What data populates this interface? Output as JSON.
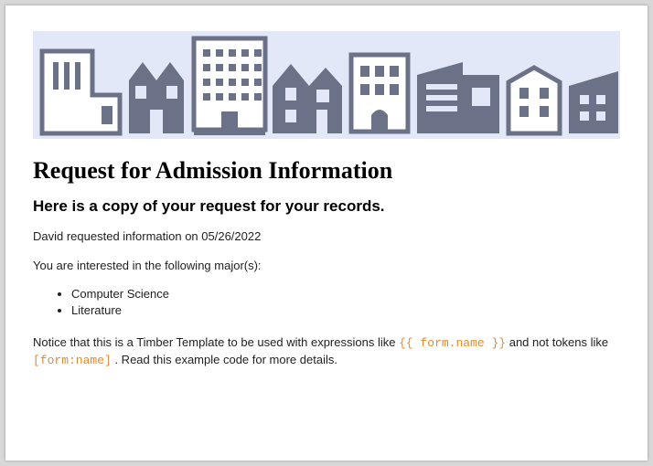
{
  "document": {
    "title": "Request for Admission Information",
    "subtitle": "Here is a copy of your request for your records.",
    "request_line": "David requested information on 05/26/2022",
    "majors_intro": "You are interested in the following major(s):",
    "majors": [
      "Computer Science",
      "Literature"
    ],
    "notice_before": "Notice that this is a Timber Template to be used with expressions like ",
    "notice_code1": "{{ form.name }}",
    "notice_middle": " and not tokens like ",
    "notice_code2": "[form:name]",
    "notice_after": ". Read this example code for more details."
  }
}
